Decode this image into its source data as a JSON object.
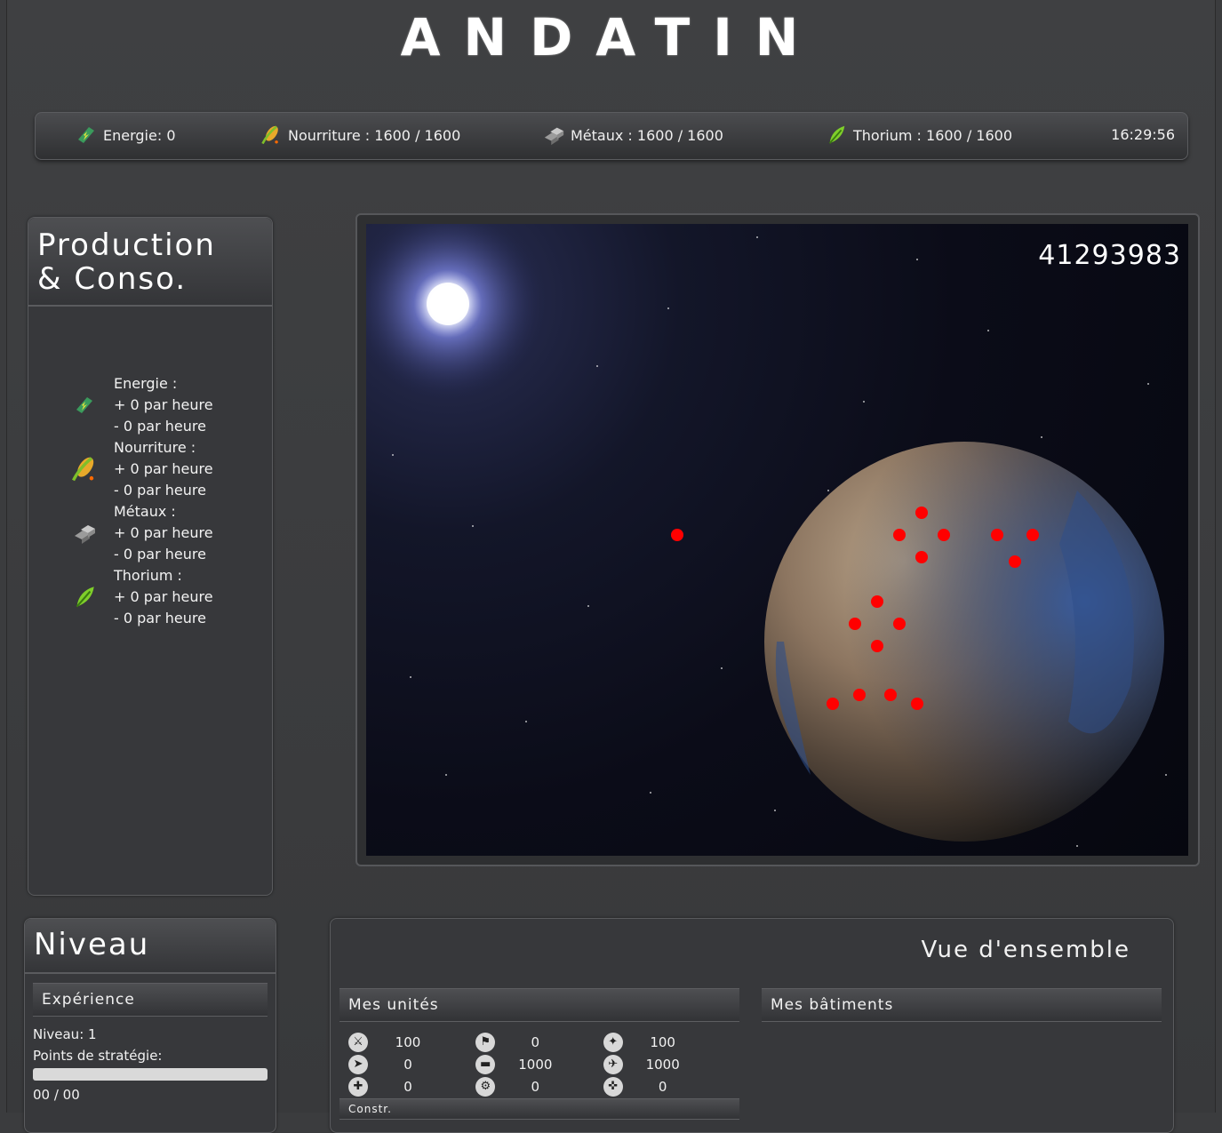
{
  "logo": "ANDATIN",
  "resources": {
    "energy": "Energie: 0",
    "food": "Nourriture : 1600 / 1600",
    "metals": "Métaux : 1600 / 1600",
    "thorium": "Thorium : 1600 / 1600",
    "clock": "16:29:56",
    "icons": [
      "energy-icon",
      "food-icon",
      "metals-icon",
      "thorium-icon"
    ]
  },
  "production": {
    "title_line1": "Production",
    "title_line2": "& Conso.",
    "items": [
      {
        "label": "Energie :",
        "plus": "+ 0 par heure",
        "minus": "- 0 par heure",
        "icon": "energy-icon"
      },
      {
        "label": "Nourriture :",
        "plus": "+ 0 par heure",
        "minus": "- 0 par heure",
        "icon": "food-icon"
      },
      {
        "label": "Métaux :",
        "plus": "+ 0 par heure",
        "minus": "- 0 par heure",
        "icon": "metals-icon"
      },
      {
        "label": "Thorium :",
        "plus": "+ 0 par heure",
        "minus": "- 0 par heure",
        "icon": "thorium-icon"
      }
    ]
  },
  "planet_view": {
    "coordinates": "41293983",
    "marker_color": "#ff0000",
    "marker_count": 18
  },
  "level": {
    "title": "Niveau",
    "experience_header": "Expérience",
    "level_text": "Niveau: 1",
    "strategy_label": "Points de stratégie:",
    "strategy_value": "00 / 00",
    "strategy_progress": 0
  },
  "overview": {
    "title": "Vue d'ensemble",
    "units_header": "Mes unités",
    "buildings_header": "Mes bâtiments",
    "units": [
      {
        "icon": "infantry-icon",
        "value": "100"
      },
      {
        "icon": "soldier-icon",
        "value": "0"
      },
      {
        "icon": "grenadier-icon",
        "value": "100"
      },
      {
        "icon": "scout-icon",
        "value": "0"
      },
      {
        "icon": "tank-icon",
        "value": "1000"
      },
      {
        "icon": "aircraft-icon",
        "value": "1000"
      },
      {
        "icon": "medic-icon",
        "value": "0"
      },
      {
        "icon": "mech-icon",
        "value": "0"
      },
      {
        "icon": "sniper-icon",
        "value": "0"
      }
    ],
    "next_header": "Constr."
  }
}
